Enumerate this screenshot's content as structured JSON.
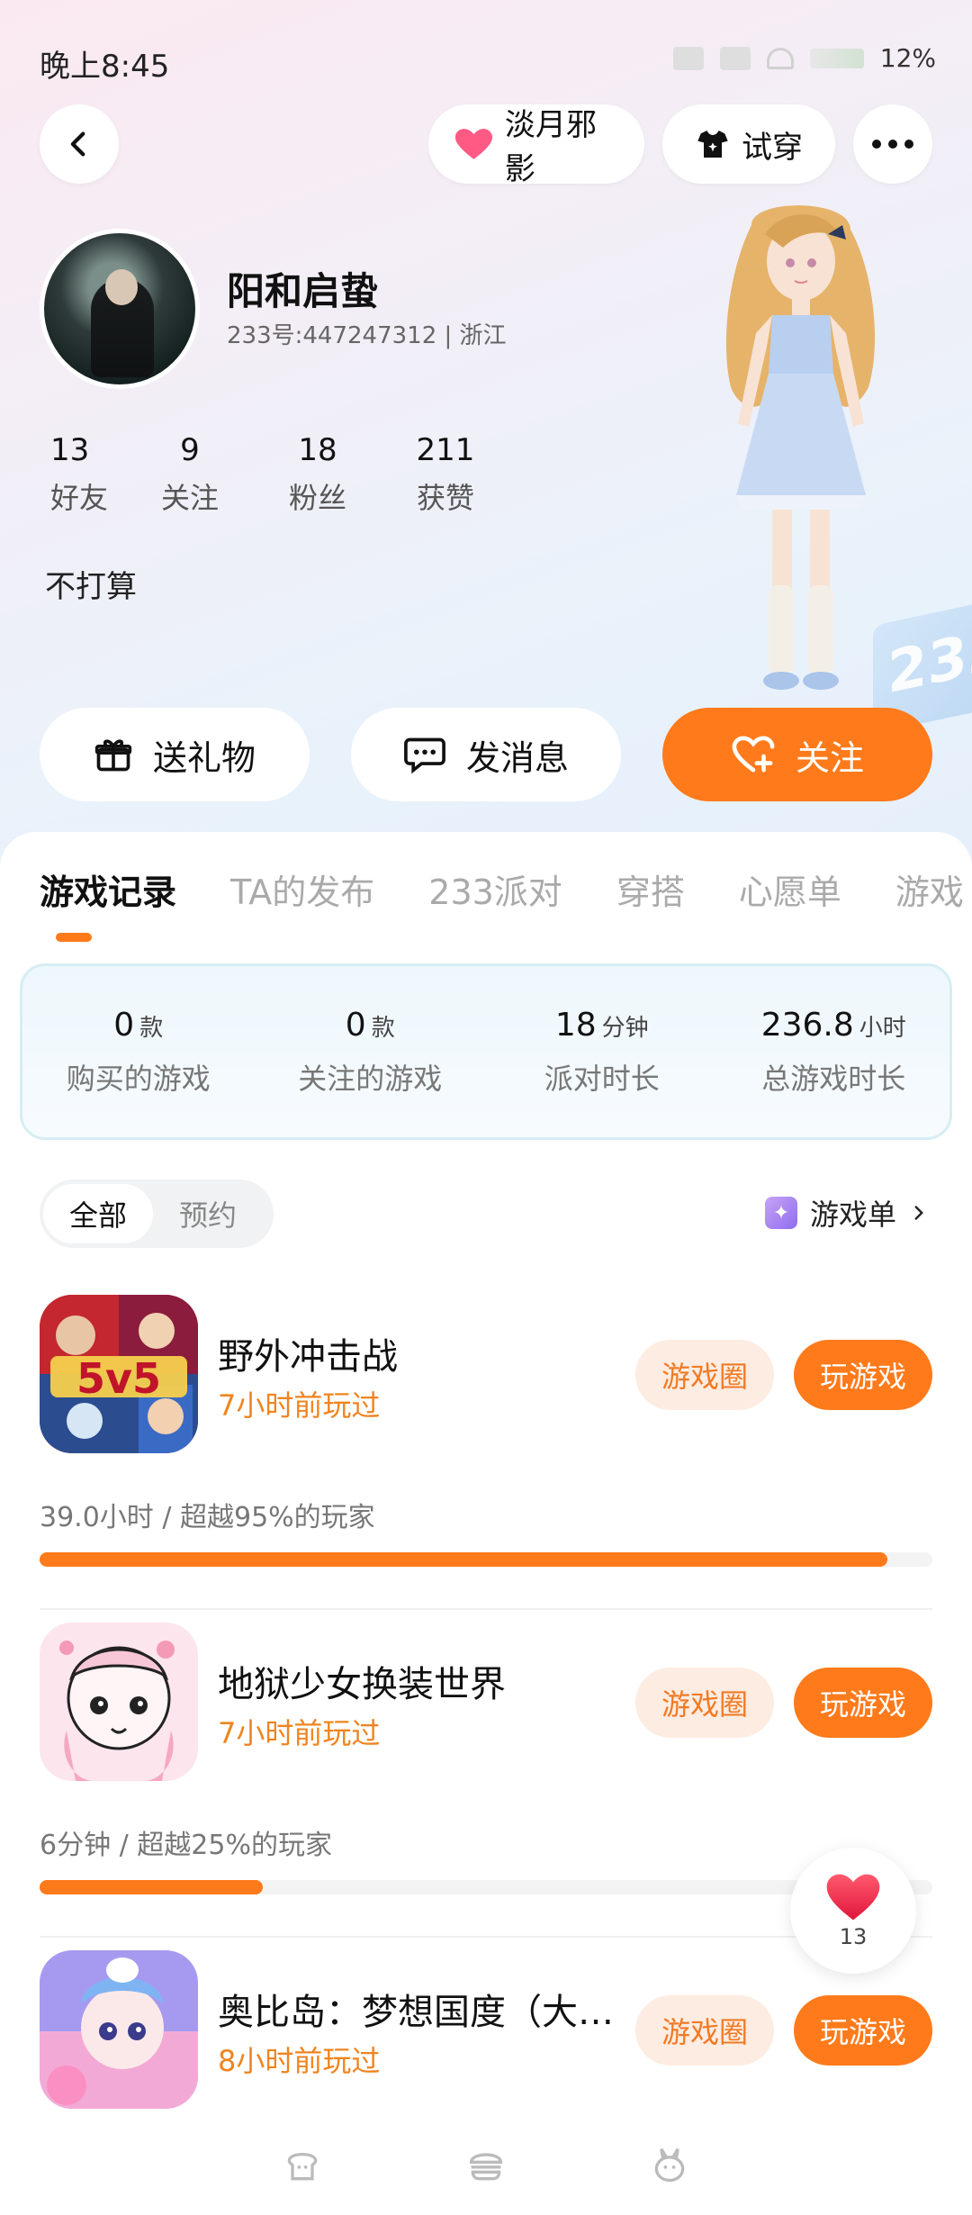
{
  "status_bar": {
    "time": "晚上8:45",
    "battery": "12%"
  },
  "header": {
    "mood_label": "淡月邪影",
    "tryon_label": "试穿"
  },
  "profile": {
    "name": "阳和启蛰",
    "meta": "233号:447247312 | 浙江",
    "stats": [
      {
        "num": "13",
        "label": "好友"
      },
      {
        "num": "9",
        "label": "关注"
      },
      {
        "num": "18",
        "label": "粉丝"
      },
      {
        "num": "211",
        "label": "获赞"
      }
    ],
    "bio": "不打算",
    "badge_text": "233"
  },
  "actions": {
    "gift": "送礼物",
    "message": "发消息",
    "follow": "关注"
  },
  "tabs": [
    "游戏记录",
    "TA的发布",
    "233派对",
    "穿搭",
    "心愿单",
    "游戏"
  ],
  "summary": [
    {
      "value": "0",
      "unit": "款",
      "label": "购买的游戏"
    },
    {
      "value": "0",
      "unit": "款",
      "label": "关注的游戏"
    },
    {
      "value": "18",
      "unit": "分钟",
      "label": "派对时长"
    },
    {
      "value": "236.8",
      "unit": "小时",
      "label": "总游戏时长"
    }
  ],
  "filter": {
    "all": "全部",
    "reserve": "预约",
    "gamelist": "游戏单"
  },
  "games": [
    {
      "title": "野外冲击战",
      "time": "7小时前玩过",
      "stats": "39.0小时 / 超越95%的玩家",
      "progress": 0.95,
      "icon_text": "5v5",
      "circle": "游戏圈",
      "play": "玩游戏"
    },
    {
      "title": "地狱少女换装世界",
      "time": "7小时前玩过",
      "stats": "6分钟 / 超越25%的玩家",
      "progress": 0.25,
      "icon_text": "",
      "circle": "游戏圈",
      "play": "玩游戏"
    },
    {
      "title": "奥比岛：梦想国度（大航...",
      "time": "8小时前玩过",
      "stats": "",
      "progress": null,
      "icon_text": "",
      "circle": "游戏圈",
      "play": "玩游戏"
    }
  ],
  "like_float": {
    "count": "13"
  },
  "colors": {
    "accent": "#ff7a1a",
    "accent_soft": "#fdece1",
    "like": "#f0304f"
  }
}
